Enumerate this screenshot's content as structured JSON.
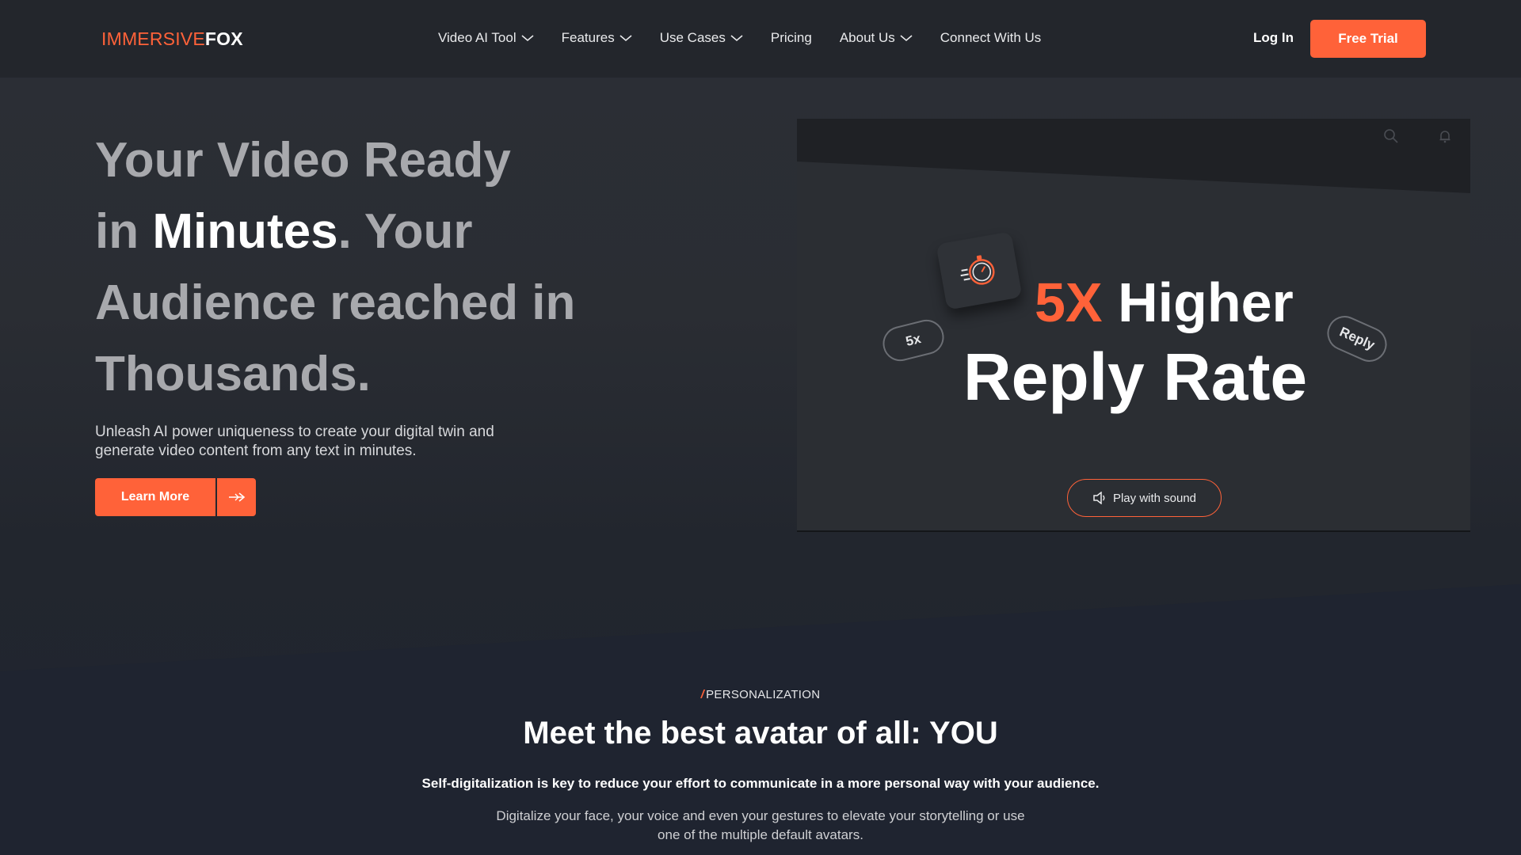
{
  "nav": {
    "logo_part1": "IMMERSIVE",
    "logo_part2": "FOX",
    "items": [
      {
        "label": "Video AI Tool",
        "dropdown": true
      },
      {
        "label": "Features",
        "dropdown": true
      },
      {
        "label": "Use Cases",
        "dropdown": true
      },
      {
        "label": "Pricing",
        "dropdown": false
      },
      {
        "label": "About Us",
        "dropdown": true
      },
      {
        "label": "Connect With Us",
        "dropdown": false
      }
    ],
    "login": "Log In",
    "cta": "Free Trial"
  },
  "hero": {
    "headline_1": "Your Video Ready",
    "headline_2a": "in ",
    "headline_2b": "Minutes",
    "headline_2c": ". Your",
    "headline_3": "Audience reached in",
    "headline_4": "Thousands.",
    "subtitle": "Unleash AI power uniqueness to create your digital twin and generate video content from any text in minutes.",
    "learn_more": "Learn More"
  },
  "video": {
    "pill_left": "5x",
    "pill_right": "Reply",
    "title_accent": "5X",
    "title_rest": " Higher",
    "title_line2": "Reply Rate",
    "play_label": "Play with sound"
  },
  "section": {
    "tag": "PERSONALIZATION",
    "title": "Meet the best avatar of all: YOU",
    "bold_line": "Self-digitalization is key to reduce your effort to communicate in a more personal way with your audience.",
    "description": "Digitalize your face, your voice and even your gestures to elevate your storytelling or use one of the multiple default avatars."
  },
  "colors": {
    "accent": "#ff6239",
    "background": "#23262d"
  }
}
